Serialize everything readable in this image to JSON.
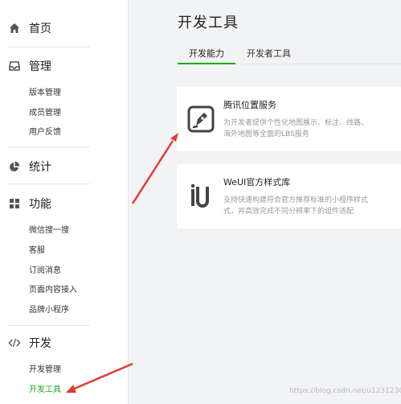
{
  "sidebar": {
    "home": "首页",
    "manage": "管理",
    "manage_items": [
      "版本管理",
      "成员管理",
      "用户反馈"
    ],
    "stats": "统计",
    "features": "功能",
    "feature_items": [
      "微信搜一搜",
      "客服",
      "订阅消息",
      "页面内容接入",
      "品牌小程序"
    ],
    "dev": "开发",
    "dev_items": [
      "开发管理",
      "开发工具"
    ]
  },
  "main": {
    "title": "开发工具",
    "tabs": [
      "开发能力",
      "开发者工具"
    ],
    "cards": [
      {
        "title": "腾讯位置服务",
        "desc_lines": [
          "为开发者提供个性化地图展示、标注、线路、",
          "海外地图等全面的LBS服务"
        ],
        "icon": "map-pen-icon"
      },
      {
        "title": "WeUI官方样式库",
        "desc_lines": [
          "支持快速构建符合官方推荐标准的小程序样式",
          "式，并高效完成不同分辨率下的组件适配"
        ],
        "icon": "weui-icon"
      }
    ]
  },
  "watermark": "https://blog.csdn.net/u1231230",
  "colors": {
    "accent": "#1aad19",
    "arrow": "#e53935"
  }
}
